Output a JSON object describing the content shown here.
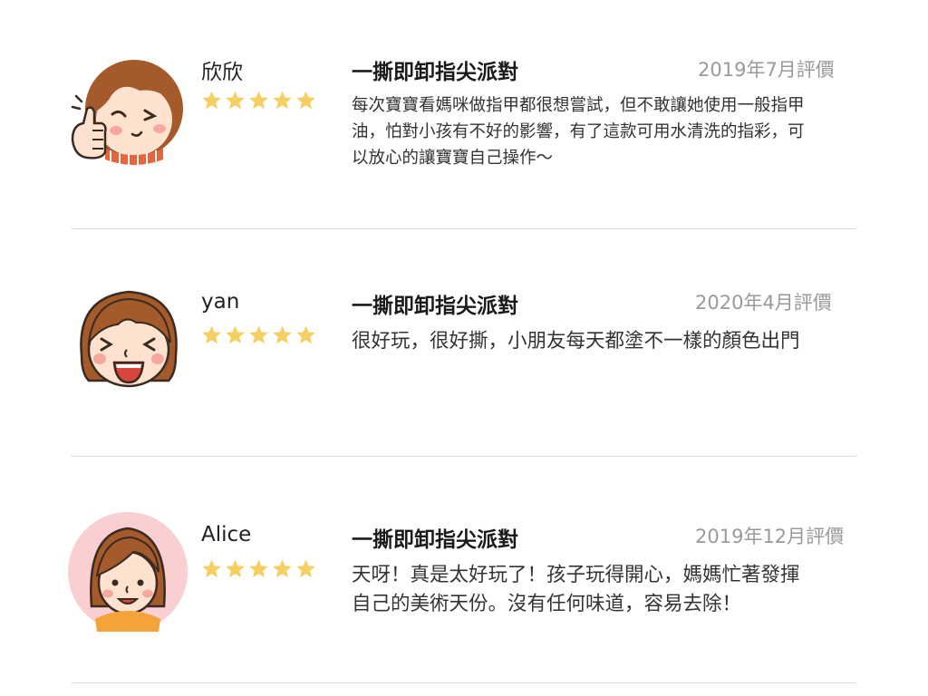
{
  "reviews": [
    {
      "name": "欣欣",
      "rating": 5,
      "product": "一撕即卸指尖派對",
      "date": "2019年7月評價",
      "comment_lines": [
        "每次寶寶看媽咪做指甲都很想嘗試，但不敢讓她使用一般指甲",
        "油，怕對小孩有不好的影響，有了這款可用水清洗的指彩，可",
        "以放心的讓寶寶自己操作～"
      ],
      "avatar": "thumbs-up-girl-avatar"
    },
    {
      "name": "yan",
      "rating": 5,
      "product": "一撕即卸指尖派對",
      "date": "2020年4月評價",
      "comment_lines": [
        "很好玩，很好撕，小朋友每天都塗不一樣的顏色出門"
      ],
      "avatar": "laughing-girl-avatar"
    },
    {
      "name": "Alice",
      "rating": 5,
      "product": "一撕即卸指尖派對",
      "date": "2019年12月評價",
      "comment_lines": [
        "天呀！真是太好玩了！孩子玩得開心，媽媽忙著發揮",
        "自己的美術天份。沒有任何味道，容易去除！"
      ],
      "avatar": "smiling-girl-pink-avatar"
    }
  ],
  "colors": {
    "star": "#f5cf63",
    "divider": "#dcdcdc",
    "date_text": "#9a9a9a",
    "avatar_pink_bg": "#f9cfd1",
    "hair_brown": "#a45a2a"
  }
}
